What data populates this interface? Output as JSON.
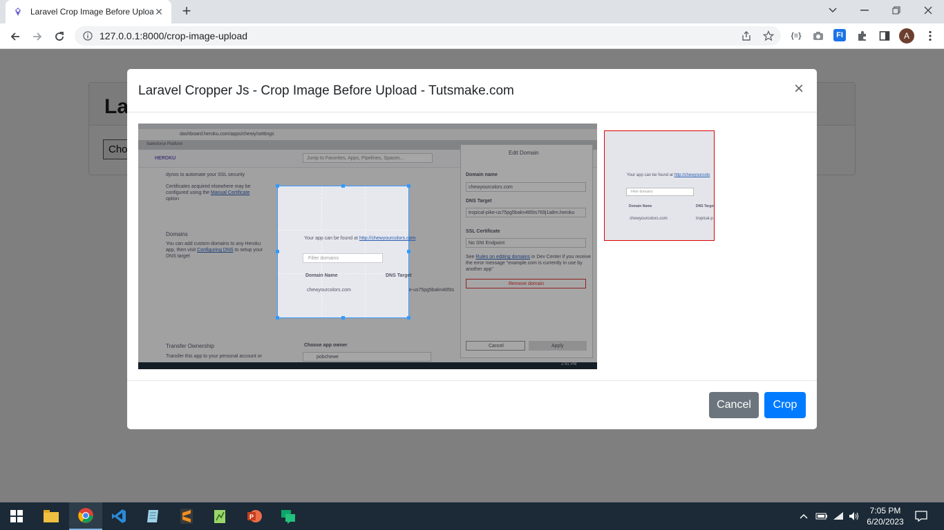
{
  "browser": {
    "tab_title": "Laravel Crop Image Before Uploa",
    "url": "127.0.0.1:8000/crop-image-upload",
    "profile_initial": "A"
  },
  "page": {
    "card_title_visible": "La",
    "file_button_visible": "Cho"
  },
  "modal": {
    "title": "Laravel Cropper Js - Crop Image Before Upload - Tutsmake.com",
    "close_symbol": "×",
    "cancel_label": "Cancel",
    "crop_label": "Crop"
  },
  "crop_image": {
    "url_bar": "dashboard.heroku.com/apps/chewy/settings",
    "platform": "Salesforce Platform",
    "heroku": "HEROKU",
    "search_placeholder": "Jump to Favorites, Apps, Pipelines, Spaces...",
    "ssl_text_1": "dynos to automate your SSL security",
    "ssl_text_2": "Certificates acquired elsewhere may be",
    "ssl_text_3": "configured using the",
    "ssl_link": "Manual Certificate",
    "ssl_text_4": "option",
    "domains_heading": "Domains",
    "domains_text_1": "You can add custom domains to any Heroku",
    "domains_text_2": "app, then visit",
    "domains_link": "Configuring DNS",
    "domains_text_3": "to setup your",
    "domains_text_4": "DNS target",
    "app_found_text": "Your app can be found at",
    "app_link": "http://chewyourcolors.com",
    "filter_placeholder": "Filter domains",
    "col_domain": "Domain Name",
    "col_dns": "DNS Target",
    "row_domain": "chewyourcolors.com",
    "row_dns": "tropical-pike-us75pg5bakn485ts",
    "transfer_heading": "Transfer Ownership",
    "transfer_text": "Transfer this app to your personal account or",
    "choose_owner": "Choose app owner",
    "owner_value": "pobchewe",
    "dialog_title": "Edit Domain",
    "dialog_domain_label": "Domain name",
    "dialog_domain_value": "chewyourcolors.com",
    "dialog_dns_label": "DNS Target",
    "dialog_dns_value": "tropical-pike-us75pg5bakn485ts769j1a8m.heroku",
    "dialog_ssl_label": "SSL Certificate",
    "dialog_ssl_value": "No SNI Endpoint",
    "dialog_note_1": "See",
    "dialog_note_link": "Rules on editing domains",
    "dialog_note_2": "in Dev Center if you receive",
    "dialog_note_3": "the error message \"example.com is currently in use by",
    "dialog_note_4": "another app\"",
    "dialog_remove": "Remove domain",
    "dialog_cancel": "Cancel",
    "dialog_apply": "Apply",
    "inner_time": "2:41 PM"
  },
  "preview": {
    "app_found_text": "Your app can be found at",
    "app_link": "http://chewyourcolo",
    "filter_placeholder": "Filter domains",
    "col_domain": "Domain Name",
    "col_dns": "DNS Target",
    "row_domain": "chewyourcolors.com",
    "row_dns": "tropical-p"
  },
  "taskbar": {
    "time": "7:05 PM",
    "date": "6/20/2023"
  }
}
